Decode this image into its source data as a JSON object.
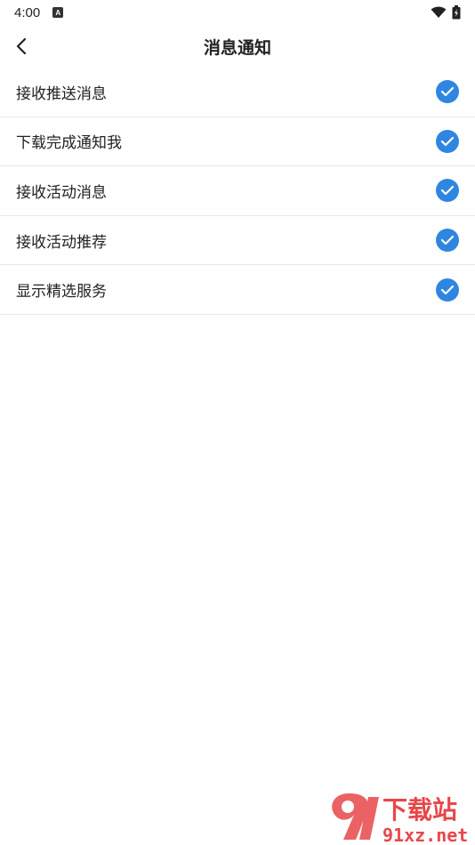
{
  "status_bar": {
    "time": "4:00",
    "notification_letter": "A"
  },
  "header": {
    "title": "消息通知",
    "back_icon": "chevron-left-icon"
  },
  "settings": [
    {
      "label": "接收推送消息",
      "checked": true
    },
    {
      "label": "下载完成通知我",
      "checked": true
    },
    {
      "label": "接收活动消息",
      "checked": true
    },
    {
      "label": "接收活动推荐",
      "checked": true
    },
    {
      "label": "显示精选服务",
      "checked": true
    }
  ],
  "watermark": {
    "brand_cn": "下载站",
    "domain": "91xz.net"
  },
  "colors": {
    "accent": "#2f86e0",
    "divider": "#e8e8e8",
    "watermark_red": "#e8474a"
  }
}
